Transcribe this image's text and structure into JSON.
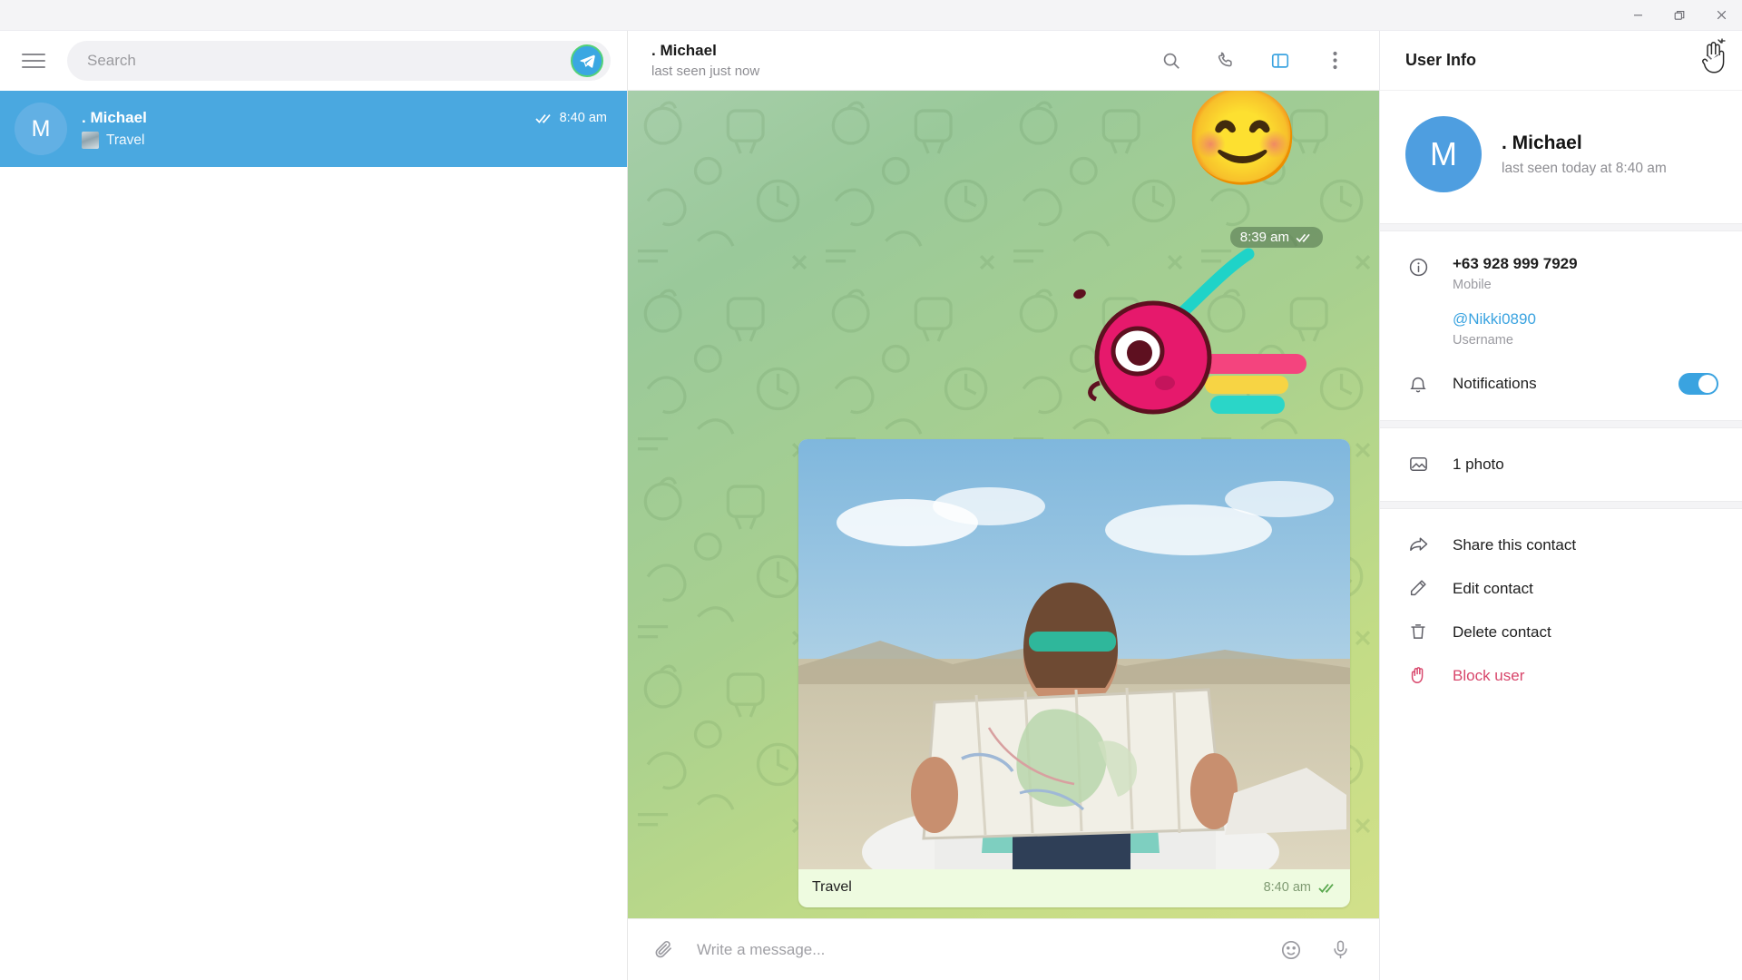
{
  "window": {
    "minimize_label": "Minimize",
    "maximize_label": "Restore",
    "close_label": "Close"
  },
  "sidebar": {
    "menu_label": "Menu",
    "search": {
      "placeholder": "Search",
      "value": ""
    },
    "send_button_label": "Telegram",
    "chats": [
      {
        "avatar_letter": "M",
        "name": ". Michael",
        "preview": "Travel",
        "time": "8:40 am",
        "status_ticks": "✓✓",
        "selected": true
      }
    ]
  },
  "chat_header": {
    "name": ". Michael",
    "status": "last seen just now",
    "icons": [
      {
        "name": "search-icon",
        "label": "Search messages"
      },
      {
        "name": "phone-icon",
        "label": "Call"
      },
      {
        "name": "panel-toggle-icon",
        "label": "Toggle info panel"
      },
      {
        "name": "more-vertical-icon",
        "label": "More"
      }
    ]
  },
  "conversation": {
    "sticker_message": {
      "emoji": "😊",
      "time": "8:39 am",
      "status_ticks": "✓✓"
    },
    "photo_message": {
      "caption": "Travel",
      "time": "8:40 am",
      "status_ticks": "✓✓",
      "alt": "Woman holding an open paper road map in a desert landscape"
    }
  },
  "composer": {
    "attach_label": "Attach file",
    "placeholder": "Write a message...",
    "value": "",
    "emoji_label": "Emoji",
    "mic_label": "Record voice message"
  },
  "user_info": {
    "title": "User Info",
    "close_label": "Close",
    "profile": {
      "avatar_letter": "M",
      "name": ". Michael",
      "status": "last seen today at 8:40 am"
    },
    "contact": {
      "phone": "+63 928 999 7929",
      "phone_label": "Mobile",
      "username": "@Nikki0890",
      "username_label": "Username"
    },
    "notifications": {
      "label": "Notifications",
      "enabled": true
    },
    "media": {
      "photos_label": "1 photo"
    },
    "actions": [
      {
        "icon": "share-icon",
        "label": "Share this contact",
        "danger": false
      },
      {
        "icon": "pencil-icon",
        "label": "Edit contact",
        "danger": false
      },
      {
        "icon": "trash-icon",
        "label": "Delete contact",
        "danger": false
      },
      {
        "icon": "block-hand-icon",
        "label": "Block user",
        "danger": true
      }
    ]
  },
  "colors": {
    "accent": "#3aa3e0",
    "selected_chat": "#4aa8e0",
    "danger": "#d8466b",
    "bubble_out": "#eefbe0"
  }
}
